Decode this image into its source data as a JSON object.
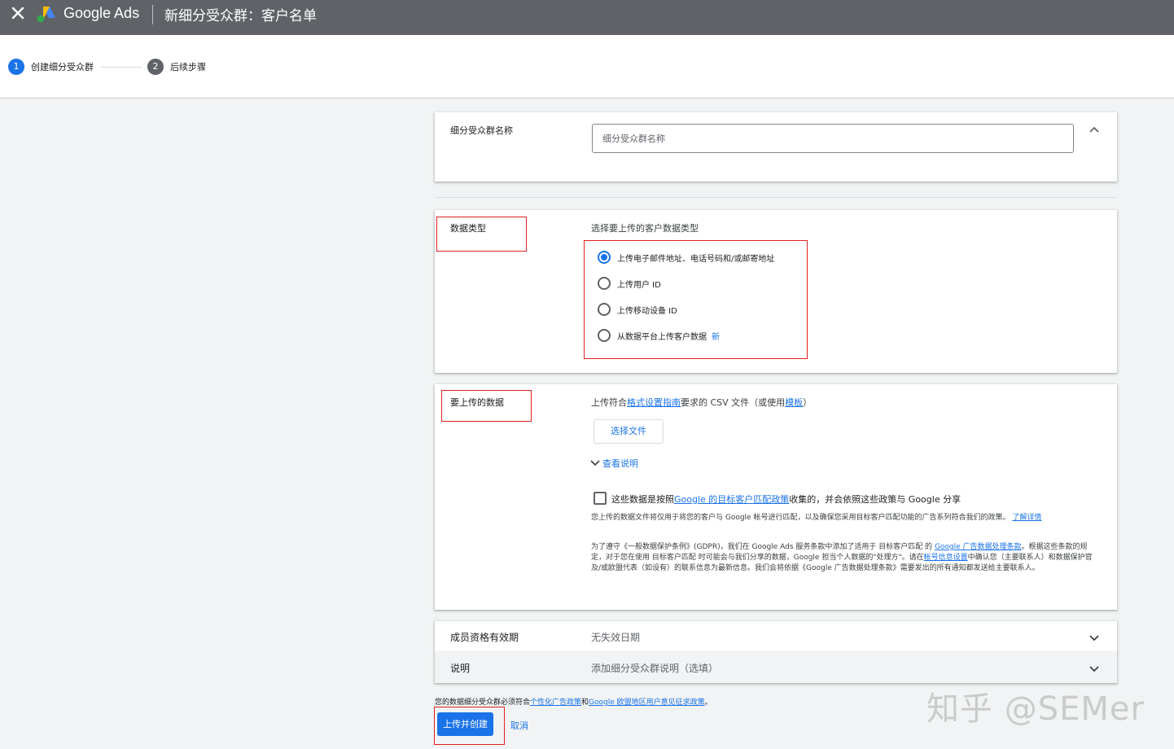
{
  "header": {
    "brand": "Google Ads",
    "title": "新细分受众群：客户名单"
  },
  "stepper": {
    "steps": [
      {
        "num": "1",
        "label": "创建细分受众群"
      },
      {
        "num": "2",
        "label": "后续步骤"
      }
    ]
  },
  "name_section": {
    "label": "细分受众群名称",
    "placeholder": "细分受众群名称"
  },
  "data_type": {
    "label": "数据类型",
    "hint": "选择要上传的客户数据类型",
    "options": [
      {
        "label": "上传电子邮件地址、电话号码和/或邮寄地址",
        "checked": true
      },
      {
        "label": "上传用户 ID",
        "checked": false
      },
      {
        "label": "上传移动设备 ID",
        "checked": false
      },
      {
        "label": "从数据平台上传客户数据",
        "checked": false,
        "badge": "新"
      }
    ]
  },
  "upload": {
    "label": "要上传的数据",
    "desc_prefix": "上传符合",
    "desc_link1": "格式设置指南",
    "desc_middle": "要求的 CSV 文件（或使用",
    "desc_link2": "模板",
    "desc_suffix": "）",
    "choose_file": "选择文件",
    "view_instructions": "查看说明",
    "consent_prefix": "这些数据是按照",
    "consent_link": "Google 的目标客户匹配政策",
    "consent_suffix": "收集的，并会依照这些政策与 Google 分享",
    "notice1": "您上传的数据文件将仅用于将您的客户与 Google 帐号进行匹配，以及确保您采用目标客户匹配功能的广告系列符合我们的政策。",
    "notice1_link": "了解详情",
    "notice2_a": "为了遵守《一般数据保护条例》(GDPR)，我们在 Google Ads 服务条款中添加了适用于 目标客户匹配 的",
    "notice2_link1": "Google 广告数据处理条款",
    "notice2_b": "。根据这些条款的规定，对于您在使用 目标客户匹配 时可能会与我们分享的数据，Google 担当个人数据的\"处理方\"。请在",
    "notice2_link2": "帐号信息设置",
    "notice2_c": "中确认您（主要联系人）和数据保护官及/或欧盟代表（如设有）的联系信息为最新信息。我们会将依据《Google 广告数据处理条款》需要发出的所有通知都发送给主要联系人。"
  },
  "membership": {
    "label": "成员资格有效期",
    "value": "无失效日期"
  },
  "description": {
    "label": "说明",
    "value": "添加细分受众群说明（选填）"
  },
  "footer": {
    "note_prefix": "您的数据细分受众群必须符合",
    "note_link1": "个性化广告政策",
    "note_and": "和",
    "note_link2": "Google 欧盟地区用户意见征求政策",
    "note_suffix": "。",
    "primary": "上传并创建",
    "cancel": "取消"
  },
  "watermark": "知乎 @SEMer",
  "colors": {
    "accent": "#1a73e8",
    "topbar": "#5f6368",
    "highlight": "#e02020"
  },
  "icons": [
    "close-icon",
    "google-ads-logo-icon",
    "chevron-up-icon",
    "chevron-down-icon"
  ]
}
